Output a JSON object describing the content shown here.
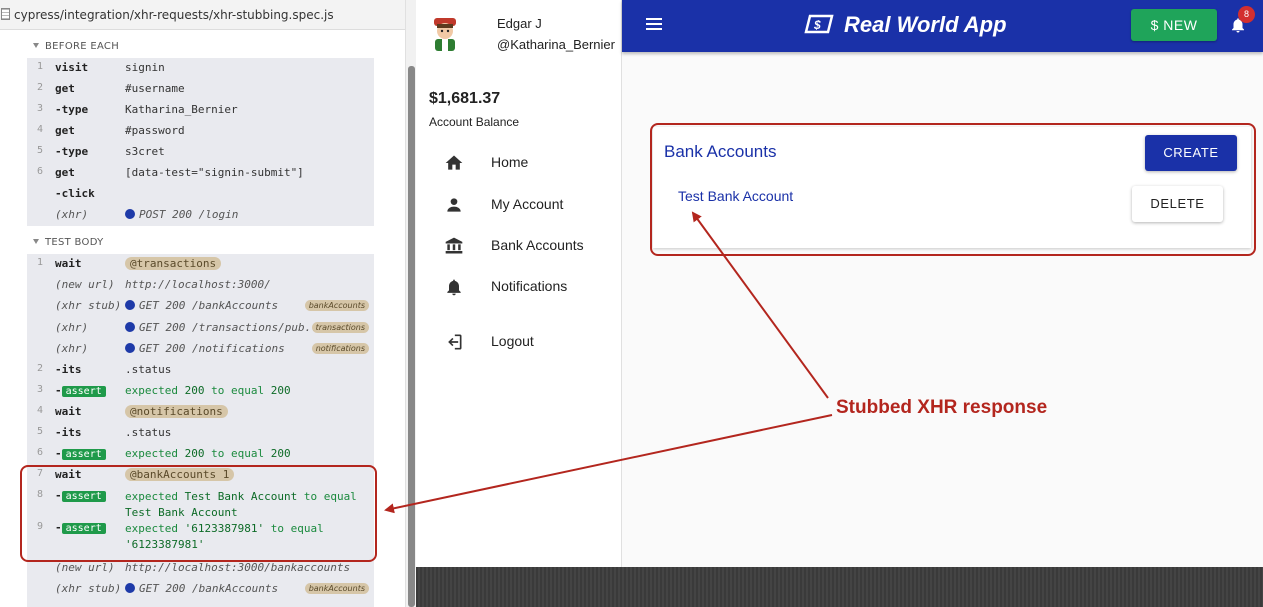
{
  "runner": {
    "spec_path": "cypress/integration/xhr-requests/xhr-stubbing.spec.js",
    "before_each": {
      "title": "BEFORE EACH",
      "rows": [
        {
          "num": "1",
          "cmd": "visit",
          "msg": "signin"
        },
        {
          "num": "2",
          "cmd": "get",
          "msg": "#username"
        },
        {
          "num": "3",
          "cmd": "-type",
          "msg": "Katharina_Bernier"
        },
        {
          "num": "4",
          "cmd": "get",
          "msg": "#password"
        },
        {
          "num": "5",
          "cmd": "-type",
          "msg": "s3cret"
        },
        {
          "num": "6",
          "cmd": "get",
          "msg": "[data-test=\"signin-submit\"]"
        },
        {
          "num": "",
          "cmd": "-click",
          "msg": ""
        },
        {
          "num": "",
          "cmd": "(xhr)",
          "msg": "POST 200 /login"
        }
      ]
    },
    "test_body": {
      "title": "TEST BODY",
      "rows": [
        {
          "num": "1",
          "cmd": "wait",
          "msg": "@transactions"
        },
        {
          "num": "",
          "cmd": "(new url)",
          "msg": "http://localhost:3000/"
        },
        {
          "num": "",
          "cmd": "(xhr stub)",
          "msg": "GET 200 /bankAccounts",
          "badge": "bankAccounts"
        },
        {
          "num": "",
          "cmd": "(xhr)",
          "msg": "GET 200 /transactions/pub...",
          "badge": "transactions"
        },
        {
          "num": "",
          "cmd": "(xhr)",
          "msg": "GET 200 /notifications",
          "badge": "notifications"
        },
        {
          "num": "2",
          "cmd": "-its",
          "msg": ".status"
        },
        {
          "num": "3",
          "cmd": "-assert",
          "msg_pre": "expected",
          "v1": "200",
          "mid": "to equal",
          "v2": "200"
        },
        {
          "num": "4",
          "cmd": "wait",
          "msg": "@notifications"
        },
        {
          "num": "5",
          "cmd": "-its",
          "msg": ".status"
        },
        {
          "num": "6",
          "cmd": "-assert",
          "msg_pre": "expected",
          "v1": "200",
          "mid": "to equal",
          "v2": "200"
        },
        {
          "num": "7",
          "cmd": "wait",
          "msg": "@bankAccounts 1"
        },
        {
          "num": "8",
          "cmd": "-assert",
          "msg_pre": "expected",
          "v1": "Test Bank Account",
          "mid": "to equal",
          "v2": "Test Bank Account"
        },
        {
          "num": "9",
          "cmd": "-assert",
          "msg_pre": "expected",
          "v1": "'6123387981'",
          "mid": "to equal",
          "v2": "'6123387981'"
        },
        {
          "num": "",
          "cmd": "(new url)",
          "msg": "http://localhost:3000/bankaccounts"
        },
        {
          "num": "",
          "cmd": "(xhr stub)",
          "msg": "GET 200 /bankAccounts",
          "badge": "bankAccounts"
        }
      ]
    },
    "assert_label": "assert"
  },
  "app": {
    "user": {
      "name": "Edgar J",
      "handle": "@Katharina_Bernier"
    },
    "balance": "$1,681.37",
    "balance_label": "Account Balance",
    "nav": [
      {
        "label": "Home",
        "icon": "home-icon"
      },
      {
        "label": "My Account",
        "icon": "person-icon"
      },
      {
        "label": "Bank Accounts",
        "icon": "bank-icon"
      },
      {
        "label": "Notifications",
        "icon": "bell-icon"
      },
      {
        "label": "Logout",
        "icon": "logout-icon"
      }
    ],
    "brand": "Real World App",
    "new_button": "$ NEW",
    "notification_count": "8",
    "card": {
      "title": "Bank Accounts",
      "create_button": "CREATE",
      "account_name": "Test Bank Account",
      "delete_button": "DELETE"
    },
    "colors": {
      "primary": "#1a31a8",
      "success": "#1fa45a",
      "annotation": "#b3261e"
    }
  },
  "annotation": {
    "callout": "Stubbed XHR response"
  }
}
